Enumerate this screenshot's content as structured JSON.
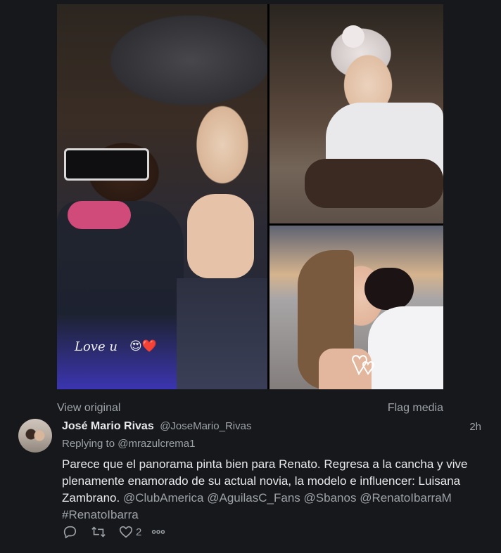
{
  "media": {
    "overlay_text": "Love u",
    "overlay_emojis": "😍❤️",
    "view_original": "View original",
    "flag_media": "Flag media"
  },
  "tweet": {
    "author_name": "José Mario Rivas",
    "author_handle": "@JoseMario_Rivas",
    "timestamp": "2h",
    "replying_prefix": "Replying to",
    "replying_to": "@mrazulcrema1",
    "text_plain": "Parece que el panorama pinta bien para Renato. Regresa a la cancha y vive plenamente enamorado de su actual novia, la modelo e influencer: Luisana Zambrano.",
    "mentions": [
      "@ClubAmerica",
      "@AguilasC_Fans",
      "@Sbanos",
      "@RenatoIbarraM"
    ],
    "hashtag": "#RenatoIbarra"
  },
  "actions": {
    "reply_icon": "reply-icon",
    "retweet_icon": "retweet-icon",
    "like_icon": "heart-icon",
    "like_count": "2",
    "more_icon": "more-icon"
  },
  "colors": {
    "background": "#16181c",
    "text_primary": "#e7e9ea",
    "text_secondary": "#9ea3a8"
  }
}
